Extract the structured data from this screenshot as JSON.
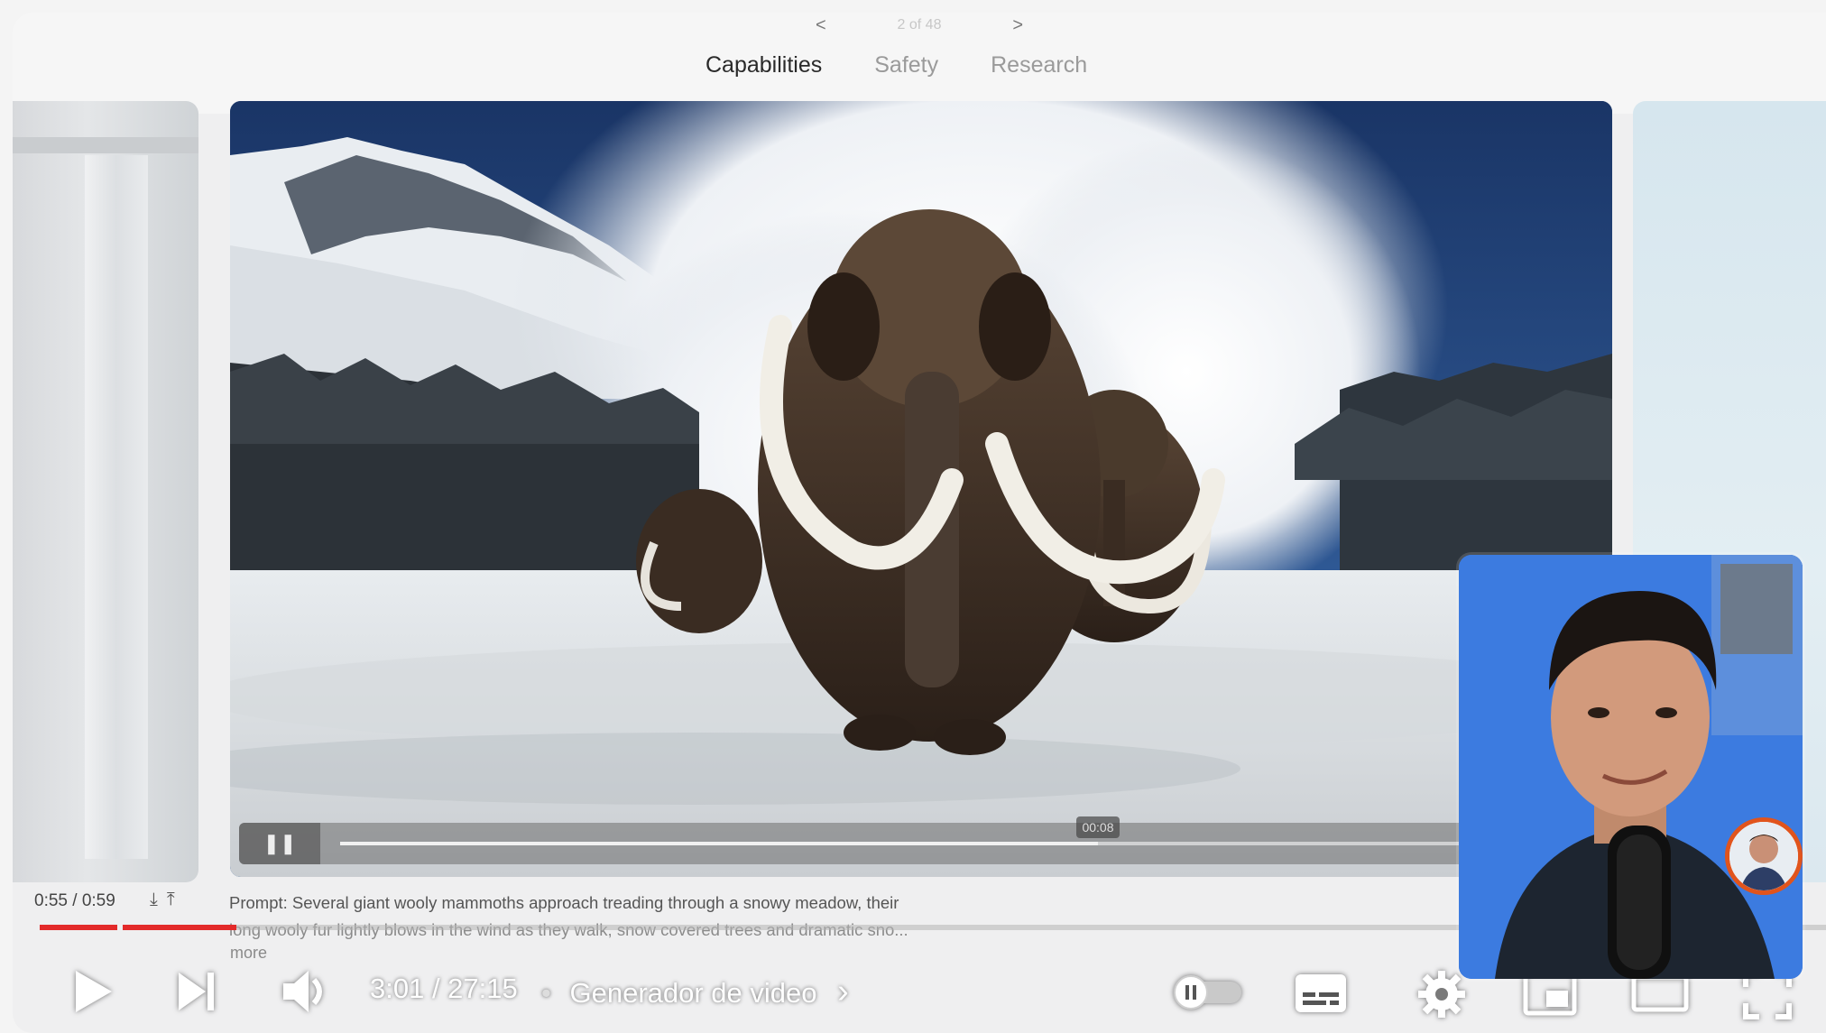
{
  "page": {
    "pager_prev": "<",
    "pager_label": "2 of 48",
    "pager_next": ">",
    "tabs": [
      {
        "label": "Capabilities",
        "active": true
      },
      {
        "label": "Safety",
        "active": false
      },
      {
        "label": "Research",
        "active": false
      }
    ]
  },
  "embedded_video": {
    "timestamp_badge": "00:08",
    "progress_fraction": 0.6
  },
  "embed_meta": {
    "time": "0:55 / 0:59"
  },
  "prompt": {
    "line1": "Prompt: Several giant wooly mammoths approach treading through a snowy meadow, their",
    "line2": "long wooly fur lightly blows in the wind as they walk, snow covered trees and dramatic sno...",
    "more": "more"
  },
  "player": {
    "progress_fraction": 0.11,
    "time": "3:01 / 27:15",
    "separator": "•",
    "chapter": "Generador de video",
    "chapter_chevron": "›"
  },
  "colors": {
    "progress_red": "#e32a2a",
    "avatar_ring": "#e1541c",
    "cam_bg": "#3d7de0"
  }
}
